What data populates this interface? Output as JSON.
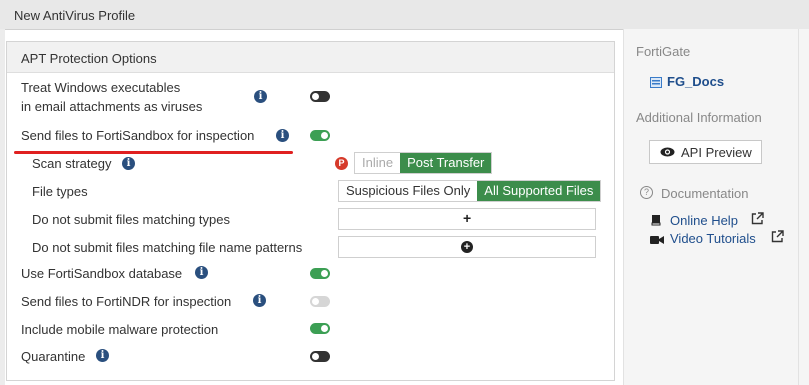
{
  "window": {
    "title": "New AntiVirus Profile"
  },
  "panel": {
    "title": "APT Protection Options",
    "rows": {
      "treat_windows_line1": "Treat Windows executables",
      "treat_windows_line2": "in email attachments as viruses",
      "send_fortisandbox": "Send files to FortiSandbox for inspection",
      "scan_strategy": "Scan strategy",
      "file_types": "File types",
      "no_submit_types": "Do not submit files matching types",
      "no_submit_patterns": "Do not submit files matching file name patterns",
      "use_fortisandbox_db": "Use FortiSandbox database",
      "send_fortindr": "Send files to FortiNDR for inspection",
      "mobile_malware": "Include mobile malware protection",
      "quarantine": "Quarantine"
    },
    "scan_strategy_options": [
      "Inline",
      "Post Transfer"
    ],
    "file_types_options": [
      "Suspicious Files Only",
      "All Supported Files"
    ],
    "toggles": {
      "treat_windows": false,
      "send_fortisandbox": true,
      "use_fortisandbox_db": true,
      "send_fortindr": false,
      "mobile_malware": true,
      "quarantine": false
    },
    "add_symbol": "+"
  },
  "sidebar": {
    "fortigate_label": "FortiGate",
    "device_name": "FG_Docs",
    "additional_info": "Additional Information",
    "api_preview": "API Preview",
    "documentation": "Documentation",
    "online_help": "Online Help",
    "video_tutorials": "Video Tutorials"
  },
  "colors": {
    "accent_green": "#3c8d4b",
    "info_blue": "#2a4f7e",
    "highlight_red": "#e02020"
  }
}
